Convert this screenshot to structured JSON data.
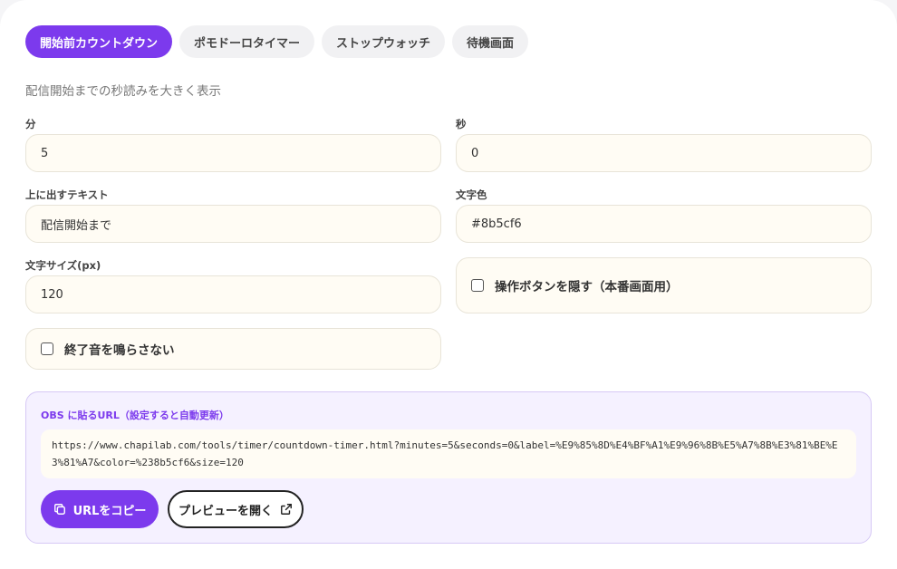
{
  "tabs": [
    {
      "label": "開始前カウントダウン",
      "active": true
    },
    {
      "label": "ポモドーロタイマー",
      "active": false
    },
    {
      "label": "ストップウォッチ",
      "active": false
    },
    {
      "label": "待機画面",
      "active": false
    }
  ],
  "description": "配信開始までの秒読みを大きく表示",
  "form": {
    "minutes": {
      "label": "分",
      "value": "5"
    },
    "seconds": {
      "label": "秒",
      "value": "0"
    },
    "label_text": {
      "label": "上に出すテキスト",
      "value": "配信開始まで"
    },
    "text_color": {
      "label": "文字色",
      "value": "#8b5cf6"
    },
    "font_size": {
      "label": "文字サイズ(px)",
      "value": "120"
    },
    "hide_buttons": {
      "label": "操作ボタンを隠す（本番画面用）",
      "checked": false
    },
    "mute_end_sound": {
      "label": "終了音を鳴らさない",
      "checked": false
    }
  },
  "obs": {
    "label": "OBS に貼るURL（設定すると自動更新）",
    "url": "https://www.chapilab.com/tools/timer/countdown-timer.html?minutes=5&seconds=0&label=%E9%85%8D%E4%BF%A1%E9%96%8B%E5%A7%8B%E3%81%BE%E3%81%A7&color=%238b5cf6&size=120",
    "copy_button": "URLをコピー",
    "preview_button": "プレビューを開く"
  },
  "colors": {
    "accent": "#7c3aed",
    "field_bg": "#fffcf4",
    "obs_bg": "#f5f1ff"
  },
  "icons": {
    "copy": "copy-icon",
    "external": "external-link-icon"
  }
}
